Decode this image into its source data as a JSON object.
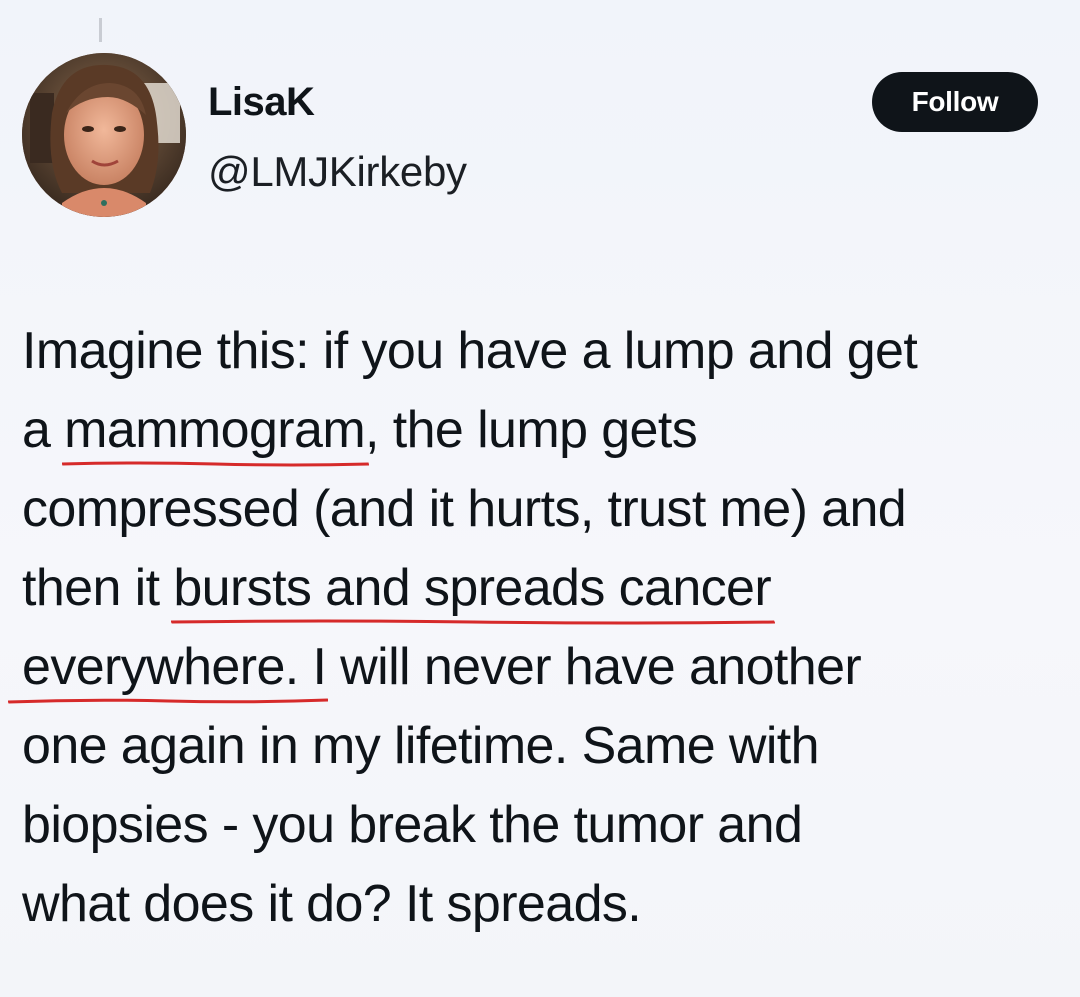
{
  "author": {
    "display_name": "LisaK",
    "handle": "@LMJKirkeby"
  },
  "follow_button": {
    "label": "Follow"
  },
  "tweet": {
    "line1": "Imagine this: if you have a lump and get",
    "line2_a": "a ",
    "line2_hl": "mammogram",
    "line2_b": ", the lump gets",
    "line3": "compressed (and it hurts, trust me) and",
    "line4_a": "then it ",
    "line4_hl": "bursts and spreads cancer",
    "line5_hl": "everywhere. I",
    "line5_b": " will never have another",
    "line6": "one again in my lifetime. Same with",
    "line7": "biopsies - you break the tumor and",
    "line8": "what does it do? It spreads."
  },
  "colors": {
    "underline": "#d62a2a",
    "follow_bg": "#0f1419",
    "text": "#0f1419"
  }
}
